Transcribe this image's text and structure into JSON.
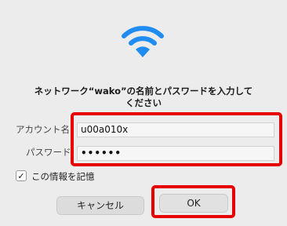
{
  "dialog": {
    "title": "ネットワーク“wako”の名前とパスワードを入力して\nください",
    "account_label": "アカウント名:",
    "account_value": "u00a010x",
    "password_label": "パスワード:",
    "password_value": "••••••",
    "remember_label": "この情報を記憶",
    "remember_checked": true,
    "remember_check_glyph": "✓",
    "cancel_label": "キャンセル",
    "ok_label": "OK"
  },
  "colors": {
    "wifi_blue": "#1e8cf0",
    "highlight_red": "#e60000",
    "background": "#ececec"
  },
  "icons": {
    "wifi": "wifi-icon",
    "check": "checkmark-icon"
  }
}
